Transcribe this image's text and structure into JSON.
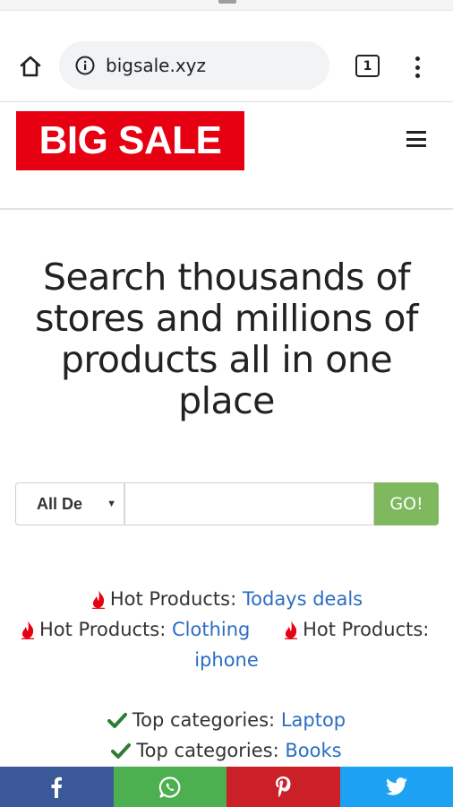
{
  "browser": {
    "url": "bigsale.xyz",
    "tab_count": "1"
  },
  "header": {
    "logo_text": "BIG SALE"
  },
  "hero": {
    "title": "Search thousands of stores and millions of products all in one place"
  },
  "search": {
    "department_selected": "All De",
    "query": "",
    "go_label": "GO!"
  },
  "hot_products": {
    "label": "Hot Products:",
    "items": [
      "Todays deals",
      "Clothing",
      "iphone"
    ]
  },
  "top_categories": {
    "label": "Top categories:",
    "items": [
      "Laptop",
      "Books"
    ]
  },
  "share": {
    "facebook_icon": "facebook-icon",
    "whatsapp_icon": "whatsapp-icon",
    "pinterest_icon": "pinterest-icon",
    "twitter_icon": "twitter-icon"
  },
  "colors": {
    "brand_red": "#e60012",
    "go_green": "#7fb85f",
    "link_blue": "#2c6cc4",
    "facebook": "#3b5998",
    "whatsapp": "#4caf50",
    "pinterest": "#cb2027",
    "twitter": "#1da1f2"
  }
}
